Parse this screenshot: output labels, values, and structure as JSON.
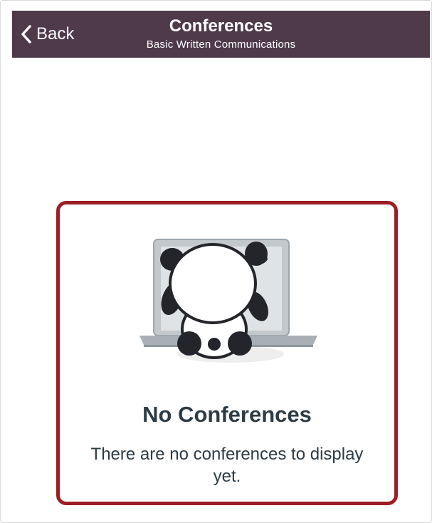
{
  "navbar": {
    "back_label": "Back",
    "title": "Conferences",
    "subtitle": "Basic Written Communications",
    "back_icon": "chevron-left-icon"
  },
  "empty_state": {
    "title": "No Conferences",
    "message": "There are no conferences to display yet.",
    "illustration": "panda-laptop-illustration"
  },
  "colors": {
    "navbar_bg": "#4f3a4a",
    "highlight_border": "#9d1d26",
    "text": "#2d3b45"
  }
}
